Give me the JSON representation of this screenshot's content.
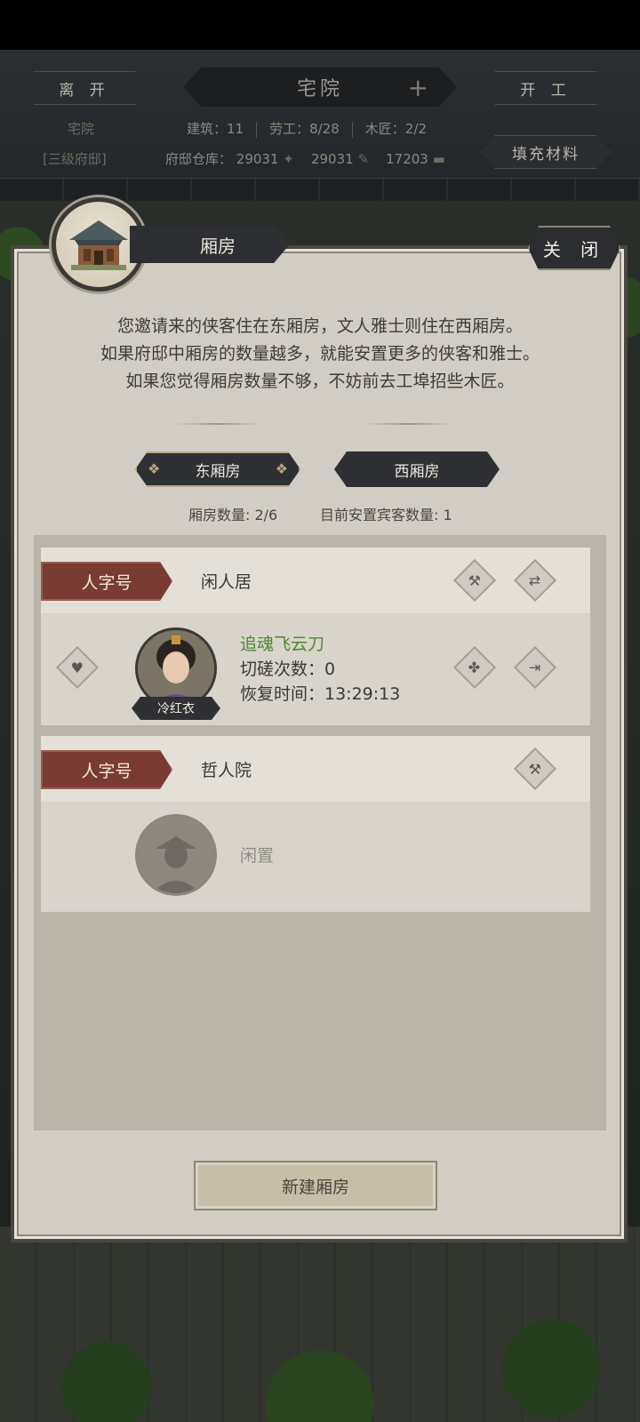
{
  "header": {
    "leave_label": "离 开",
    "title": "宅院",
    "start_work_label": "开 工",
    "fill_materials_label": "填充材料",
    "estate_name": "宅院",
    "estate_level": "[三级府邸]",
    "buildings": "建筑：11",
    "workers": "劳工：8/28",
    "carpenters": "木匠：2/2",
    "warehouse_label": "府邸仓库：",
    "warehouse_a": "29031",
    "warehouse_b": "29031",
    "warehouse_c": "17203"
  },
  "dialog": {
    "title": "厢房",
    "close_label": "关 闭",
    "desc": [
      "您邀请来的侠客住在东厢房，文人雅士则住在西厢房。",
      "如果府邸中厢房的数量越多，就能安置更多的侠客和雅士。",
      "如果您觉得厢房数量不够，不妨前去工埠招些木匠。"
    ],
    "tabs": [
      "东厢房",
      "西厢房"
    ],
    "room_count": "厢房数量: 2/6",
    "guest_count": "目前安置宾客数量: 1",
    "new_room_label": "新建厢房"
  },
  "rooms": [
    {
      "tag": "人字号",
      "name": "闲人居",
      "guest": {
        "title": "追魂飞云刀",
        "spar": "切磋次数：0",
        "recover": "恢复时间：13:29:13",
        "name": "冷红衣"
      }
    },
    {
      "tag": "人字号",
      "name": "哲人院",
      "idle": "闲置"
    }
  ],
  "colors": {
    "accent_red": "#7a3b34",
    "guest_green": "#4b8a2f",
    "dialog_bg": "#d2cdc4"
  }
}
